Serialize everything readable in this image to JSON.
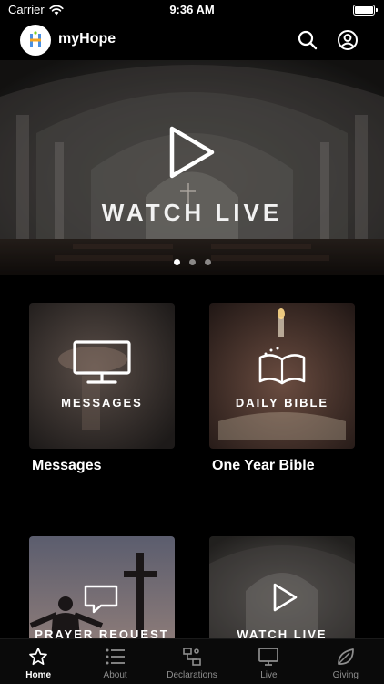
{
  "status_bar": {
    "carrier": "Carrier",
    "time": "9:36 AM"
  },
  "header": {
    "app_title": "myHope",
    "logo_letter": "H"
  },
  "hero": {
    "title": "WATCH LIVE",
    "slide_count": 3,
    "active_slide": 1
  },
  "tiles": [
    {
      "caption": "MESSAGES",
      "label": "Messages",
      "icon": "monitor-icon"
    },
    {
      "caption": "DAILY BIBLE",
      "label": "One Year Bible",
      "icon": "bible-icon"
    },
    {
      "caption": "PRAYER REQUEST",
      "label": "",
      "icon": "chat-bubble-icon"
    },
    {
      "caption": "WATCH LIVE",
      "label": "",
      "icon": "play-icon"
    }
  ],
  "tab_bar": {
    "items": [
      {
        "label": "Home",
        "icon": "star-icon",
        "active": true
      },
      {
        "label": "About",
        "icon": "list-icon",
        "active": false
      },
      {
        "label": "Declarations",
        "icon": "declarations-icon",
        "active": false
      },
      {
        "label": "Live",
        "icon": "tv-icon",
        "active": false
      },
      {
        "label": "Giving",
        "icon": "leaf-icon",
        "active": false
      }
    ]
  },
  "colors": {
    "background": "#000000",
    "text": "#ffffff",
    "inactive_tab": "#8e8e8e"
  }
}
